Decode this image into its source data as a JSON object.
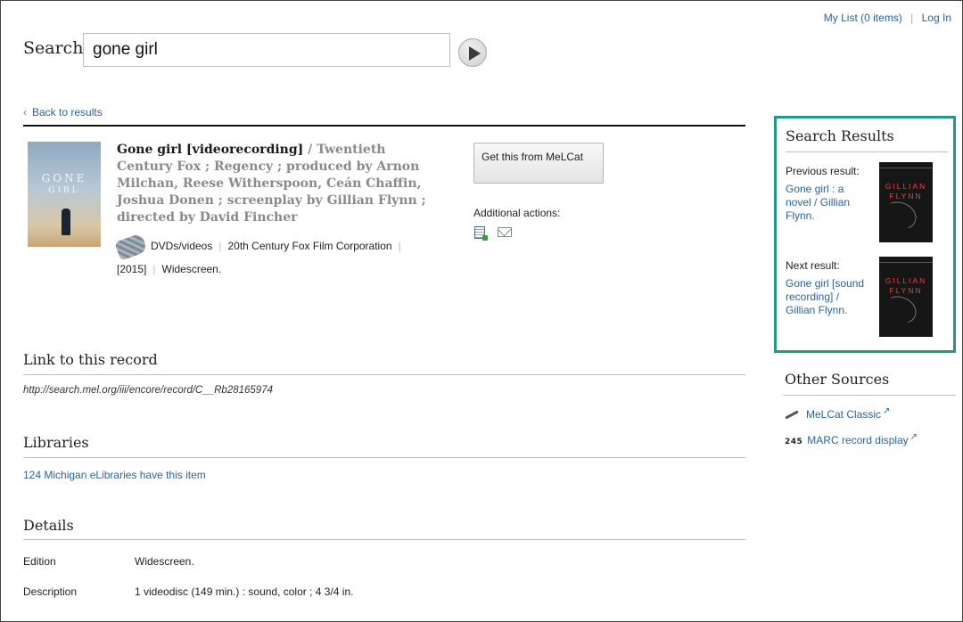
{
  "header": {
    "my_list": "My List (0 items)",
    "separator": "|",
    "log_in": "Log In"
  },
  "search": {
    "label": "Search",
    "value": "gone girl"
  },
  "nav": {
    "back_label": "Back to results"
  },
  "record": {
    "title": "Gone girl [videorecording]",
    "responsibility": "/ Twentieth Century Fox ; Regency ; produced by Arnon Milchan, Reese Witherspoon, Ceán Chaffin, Joshua Donen ; screenplay by Gillian Flynn ; directed by David Fincher",
    "cover_text_line1": "GONE",
    "cover_text_line2": "GIRL",
    "format": "DVDs/videos",
    "publisher": "20th Century Fox Film Corporation",
    "date": "[2015]",
    "edition_note": "Widescreen.",
    "format_icon": "dvd-icon"
  },
  "actions": {
    "get_button": "Get this from MeLCat",
    "additional_label": "Additional actions:",
    "icons": [
      "add-to-list-icon",
      "email-icon"
    ]
  },
  "sections": {
    "link_heading": "Link to this record",
    "record_url": "http://search.mel.org/iii/encore/record/C__Rb28165974",
    "libraries_heading": "Libraries",
    "libraries_link": "124 Michigan eLibraries have this item",
    "details_heading": "Details"
  },
  "details": [
    {
      "key": "Edition",
      "value": "Widescreen."
    },
    {
      "key": "Description",
      "value": "1 videodisc (149 min.) : sound, color ; 4 3/4 in."
    }
  ],
  "search_results": {
    "title": "Search Results",
    "previous_label": "Previous result:",
    "previous_link": "Gone girl : a novel / Gillian Flynn.",
    "next_label": "Next result:",
    "next_link": "Gone girl [sound recording] / Gillian Flynn.",
    "book_author_1": "GILLIAN",
    "book_author_2": "FLYNN"
  },
  "other_sources": {
    "title": "Other Sources",
    "items": [
      {
        "label": "MeLCat Classic",
        "icon": "feather-icon"
      },
      {
        "label": "MARC record display",
        "icon": "marc-245-icon",
        "icon_text": "245"
      }
    ]
  },
  "colors": {
    "link": "#2a63a6",
    "highlight_border": "#1f9a86"
  }
}
